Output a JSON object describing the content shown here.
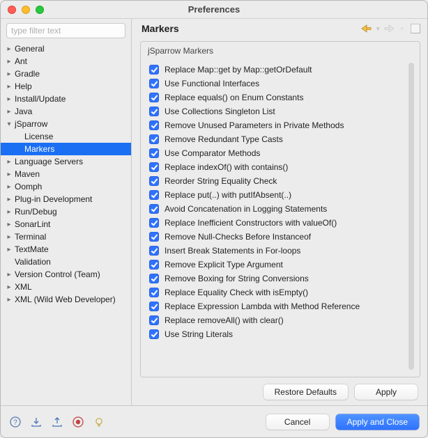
{
  "window": {
    "title": "Preferences"
  },
  "filter": {
    "placeholder": "type filter text"
  },
  "tree": [
    {
      "label": "General",
      "depth": 0,
      "expandable": true,
      "expanded": false
    },
    {
      "label": "Ant",
      "depth": 0,
      "expandable": true,
      "expanded": false
    },
    {
      "label": "Gradle",
      "depth": 0,
      "expandable": true,
      "expanded": false
    },
    {
      "label": "Help",
      "depth": 0,
      "expandable": true,
      "expanded": false
    },
    {
      "label": "Install/Update",
      "depth": 0,
      "expandable": true,
      "expanded": false
    },
    {
      "label": "Java",
      "depth": 0,
      "expandable": true,
      "expanded": false
    },
    {
      "label": "jSparrow",
      "depth": 0,
      "expandable": true,
      "expanded": true
    },
    {
      "label": "License",
      "depth": 1,
      "expandable": false,
      "expanded": false
    },
    {
      "label": "Markers",
      "depth": 1,
      "expandable": false,
      "expanded": false,
      "selected": true
    },
    {
      "label": "Language Servers",
      "depth": 0,
      "expandable": true,
      "expanded": false
    },
    {
      "label": "Maven",
      "depth": 0,
      "expandable": true,
      "expanded": false
    },
    {
      "label": "Oomph",
      "depth": 0,
      "expandable": true,
      "expanded": false
    },
    {
      "label": "Plug-in Development",
      "depth": 0,
      "expandable": true,
      "expanded": false
    },
    {
      "label": "Run/Debug",
      "depth": 0,
      "expandable": true,
      "expanded": false
    },
    {
      "label": "SonarLint",
      "depth": 0,
      "expandable": true,
      "expanded": false
    },
    {
      "label": "Terminal",
      "depth": 0,
      "expandable": true,
      "expanded": false
    },
    {
      "label": "TextMate",
      "depth": 0,
      "expandable": true,
      "expanded": false
    },
    {
      "label": "Validation",
      "depth": 0,
      "expandable": false,
      "expanded": false
    },
    {
      "label": "Version Control (Team)",
      "depth": 0,
      "expandable": true,
      "expanded": false
    },
    {
      "label": "XML",
      "depth": 0,
      "expandable": true,
      "expanded": false
    },
    {
      "label": "XML (Wild Web Developer)",
      "depth": 0,
      "expandable": true,
      "expanded": false
    }
  ],
  "page": {
    "heading": "Markers",
    "group_title": "jSparrow Markers",
    "checks": [
      "Replace Map::get by Map::getOrDefault",
      "Use Functional Interfaces",
      "Replace equals() on Enum Constants",
      "Use Collections Singleton List",
      "Remove Unused Parameters in Private Methods",
      "Remove Redundant Type Casts",
      "Use Comparator Methods",
      "Replace indexOf() with contains()",
      "Reorder String Equality Check",
      "Replace put(..) with putIfAbsent(..)",
      "Avoid Concatenation in Logging Statements",
      "Replace Inefficient Constructors with valueOf()",
      "Remove Null-Checks Before Instanceof",
      "Insert Break Statements in For-loops",
      "Remove Explicit Type Argument",
      "Remove Boxing for String Conversions",
      "Replace Equality Check with isEmpty()",
      "Replace Expression Lambda with Method Reference",
      "Replace removeAll() with clear()",
      "Use String Literals"
    ]
  },
  "buttons": {
    "restore": "Restore Defaults",
    "apply": "Apply",
    "cancel": "Cancel",
    "apply_close": "Apply and Close"
  }
}
